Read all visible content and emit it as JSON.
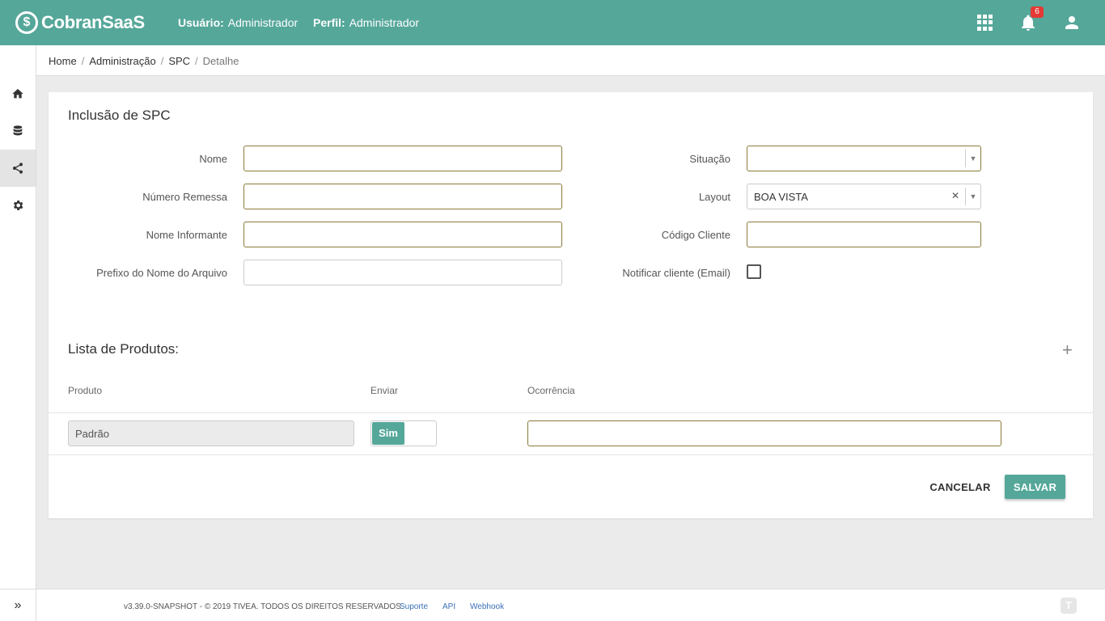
{
  "header": {
    "logo_symbol": "$",
    "app_name": "CobranSaaS",
    "user_label": "Usuário:",
    "user_value": "Administrador",
    "profile_label": "Perfil:",
    "profile_value": "Administrador",
    "notification_count": "6",
    "accent_color": "#55a799"
  },
  "sidebar": {
    "items": [
      {
        "icon": "home-icon"
      },
      {
        "icon": "database-icon"
      },
      {
        "icon": "share-icon",
        "active": true
      },
      {
        "icon": "gear-icon"
      }
    ],
    "expand_label": "»"
  },
  "breadcrumb": {
    "items": [
      "Home",
      "Administração",
      "SPC"
    ],
    "current": "Detalhe",
    "separator": "/"
  },
  "form": {
    "title": "Inclusão de SPC",
    "fields": {
      "nome": {
        "label": "Nome",
        "value": ""
      },
      "numero_remessa": {
        "label": "Número Remessa",
        "value": ""
      },
      "nome_informante": {
        "label": "Nome Informante",
        "value": ""
      },
      "prefixo": {
        "label": "Prefixo do Nome do Arquivo",
        "value": ""
      },
      "situacao": {
        "label": "Situação",
        "value": ""
      },
      "layout": {
        "label": "Layout",
        "value": "BOA VISTA"
      },
      "codigo_cliente": {
        "label": "Código Cliente",
        "value": ""
      },
      "notificar": {
        "label": "Notificar cliente (Email)",
        "checked": false
      }
    }
  },
  "products": {
    "title": "Lista de Produtos:",
    "columns": [
      "Produto",
      "Enviar",
      "Ocorrência"
    ],
    "rows": [
      {
        "produto": "Padrão",
        "enviar": "Sim",
        "ocorrencia": ""
      }
    ]
  },
  "actions": {
    "cancel_label": "CANCELAR",
    "save_label": "SALVAR"
  },
  "footer": {
    "copyright": "v3.39.0-SNAPSHOT - © 2019 TIVEA. TODOS OS DIREITOS RESERVADOS.",
    "links": [
      "Suporte",
      "API",
      "Webhook"
    ],
    "logo_symbol": "T"
  }
}
